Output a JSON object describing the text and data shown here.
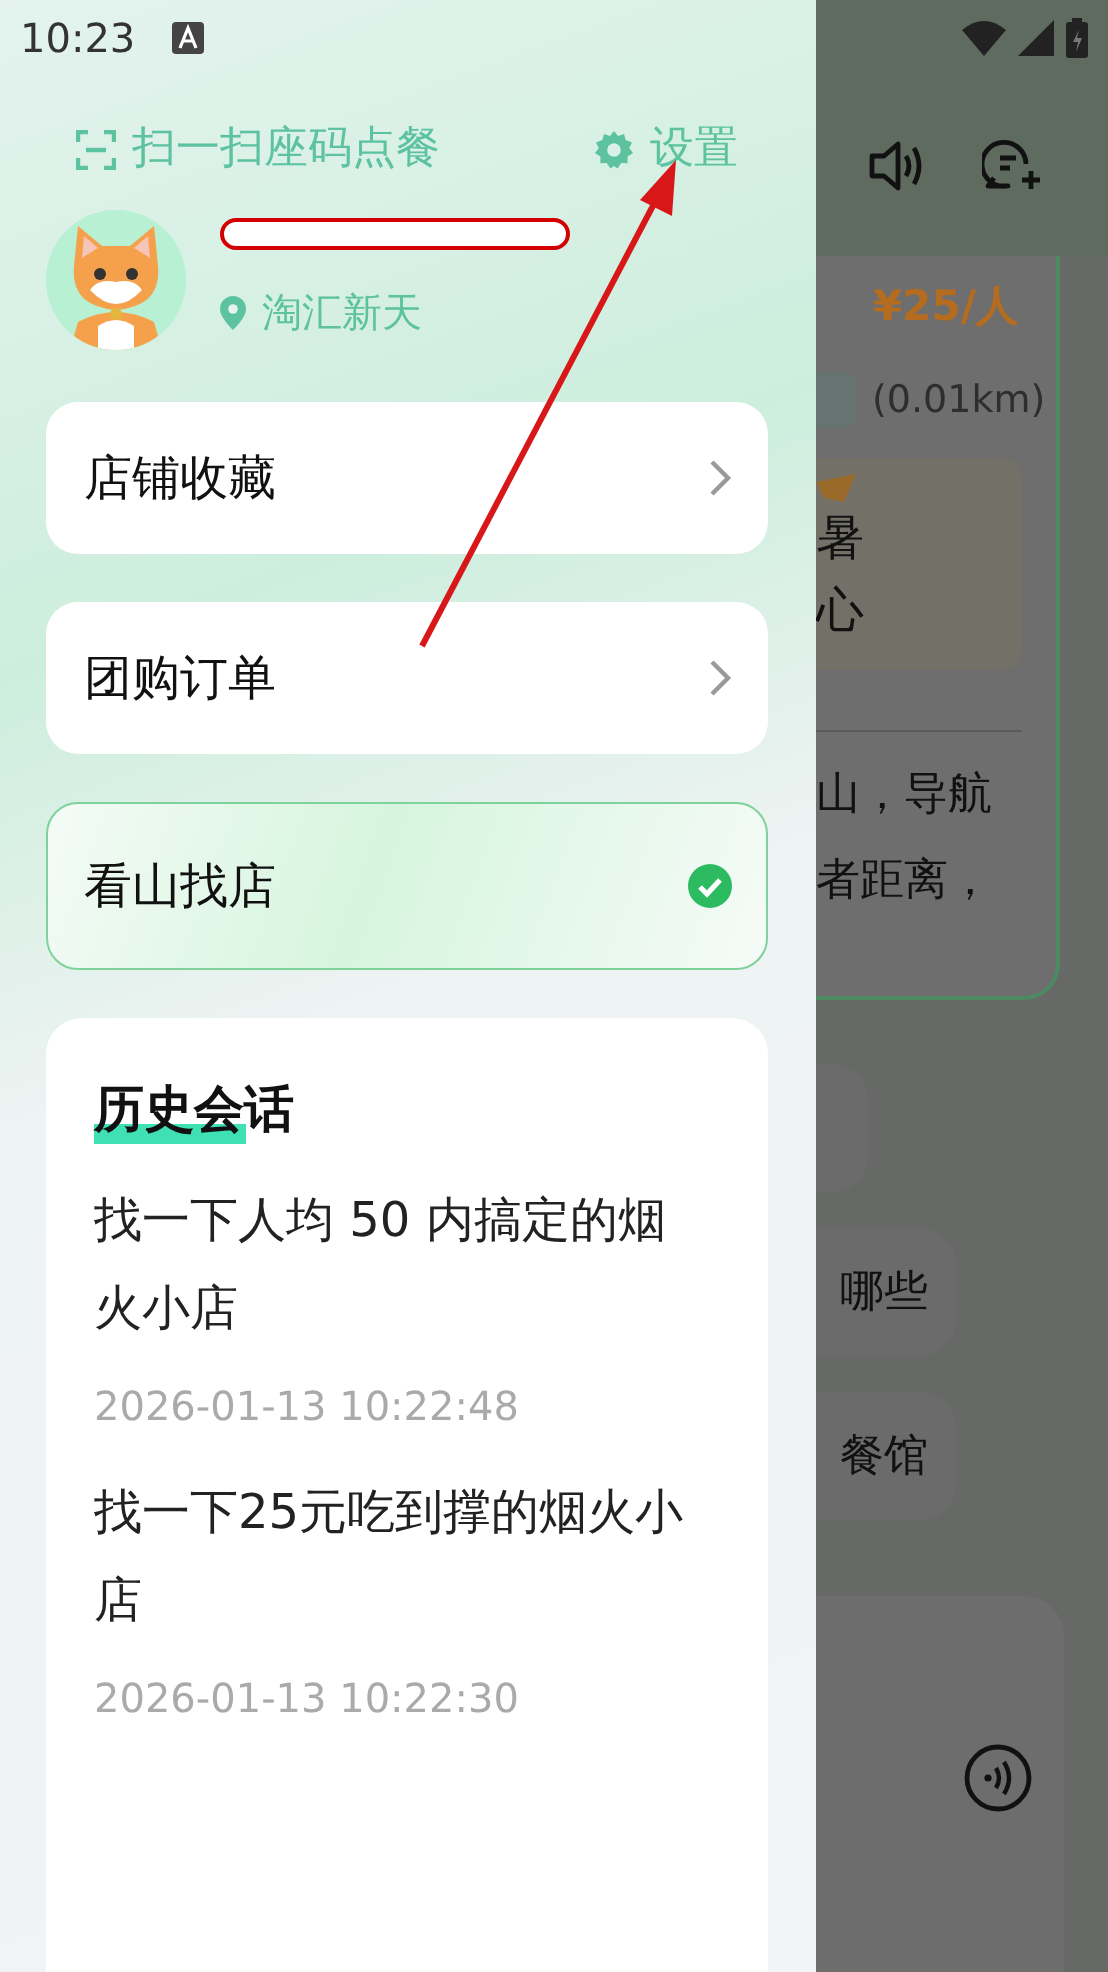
{
  "status_bar": {
    "time": "10:23"
  },
  "drawer": {
    "scan_label": "扫一扫座码点餐",
    "settings_label": "设置",
    "location": "淘汇新天",
    "menu": [
      {
        "label": "店铺收藏",
        "checked": false
      },
      {
        "label": "团购订单",
        "checked": false
      },
      {
        "label": "看山找店",
        "checked": true
      }
    ],
    "history": {
      "title": "历史会话",
      "sessions": [
        {
          "text": "找一下人均 50 内搞定的烟火小店",
          "time": "2026-01-13 10:22:48"
        },
        {
          "text": "找一下25元吃到撑的烟火小店",
          "time": "2026-01-13 10:22:30"
        }
      ]
    }
  },
  "background": {
    "price": "¥25/人",
    "distance": "(0.01km)",
    "highlight_lines": [
      "暑",
      "心"
    ],
    "description_lines": [
      "山，导航",
      "者距离，"
    ],
    "chat_bubbles": [
      "哪些",
      "餐馆"
    ]
  }
}
